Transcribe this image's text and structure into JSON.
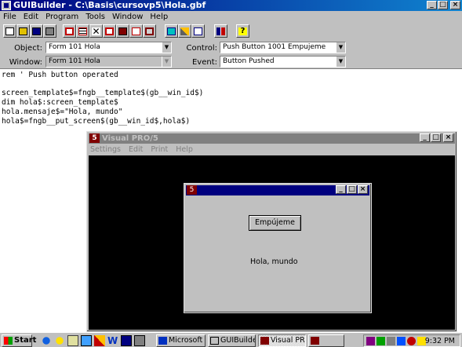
{
  "main_window": {
    "title": "GUIBuilder - C:\\Basis\\cursovp5\\Hola.gbf",
    "menu": [
      "File",
      "Edit",
      "Program",
      "Tools",
      "Window",
      "Help"
    ]
  },
  "selectors": {
    "object_label": "Object:",
    "object_value": "Form 101 Hola",
    "control_label": "Control:",
    "control_value": "Push Button 1001 Empujeme",
    "window_label": "Window:",
    "window_value": "Form 101 Hola",
    "event_label": "Event:",
    "event_value": "Button Pushed"
  },
  "editor": {
    "code": "rem ' Push button operated\n\nscreen_template$=fngb__template$(gb__win_id$)\ndim hola$:screen_template$\nhola.mensaje$=\"Hola, mundo\"\nhola$=fngb__put_screen$(gb__win_id$,hola$)"
  },
  "vp5_window": {
    "title": "Visual PRO/5",
    "menu": [
      "Settings",
      "Edit",
      "Print",
      "Help"
    ]
  },
  "form_window": {
    "button_label": "Empújeme",
    "message": "Hola, mundo"
  },
  "taskbar": {
    "start_label": "Start",
    "tasks": [
      "Microsoft ...",
      "GUIBuilder...",
      "Visual PR..."
    ],
    "clock": "9:32 PM"
  },
  "colors": {
    "active_title": "#00007f",
    "inactive_title": "#808080",
    "desktop_face": "#c0c0c0"
  }
}
